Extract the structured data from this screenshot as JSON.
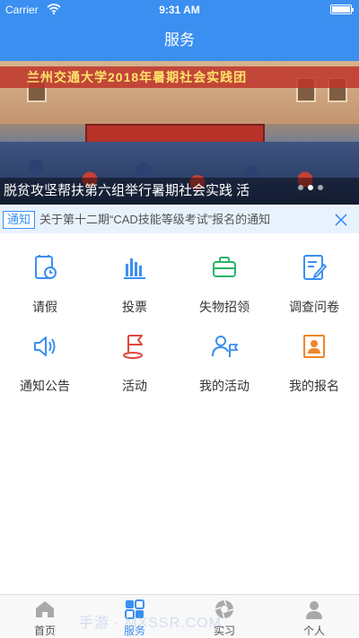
{
  "status_bar": {
    "carrier": "Carrier",
    "time": "9:31 AM",
    "battery_level": 1.0
  },
  "nav": {
    "title": "服务"
  },
  "banner": {
    "photo_text": "兰州交通大学2018年暑期社会实践团",
    "caption": "脱贫攻坚帮扶第六组举行暑期社会实践 活",
    "page_count": 3,
    "active_page": 2
  },
  "notice": {
    "tag": "通知",
    "text": "关于第十二期“CAD技能等级考试”报名的通知"
  },
  "services": [
    {
      "label": "请假",
      "icon": "leave-request-icon"
    },
    {
      "label": "投票",
      "icon": "bar-chart-icon"
    },
    {
      "label": "失物招领",
      "icon": "lost-found-bag-icon"
    },
    {
      "label": "调查问卷",
      "icon": "survey-edit-icon"
    },
    {
      "label": "通知公告",
      "icon": "speaker-icon"
    },
    {
      "label": "活动",
      "icon": "flag-icon"
    },
    {
      "label": "我的活动",
      "icon": "person-flag-icon"
    },
    {
      "label": "我的报名",
      "icon": "id-card-icon"
    }
  ],
  "tabs": [
    {
      "label": "首页",
      "icon": "home-icon",
      "active": false
    },
    {
      "label": "服务",
      "icon": "services-grid-icon",
      "active": true
    },
    {
      "label": "实习",
      "icon": "aperture-icon",
      "active": false
    },
    {
      "label": "个人",
      "icon": "person-icon",
      "active": false
    }
  ],
  "watermark": "手游 · MXSSR.COM",
  "colors": {
    "primary": "#3a8ff0",
    "notice_bg": "#e8f2fd",
    "red_icon": "#e0483e",
    "green_icon": "#2bb36a",
    "orange_icon": "#f0862a"
  }
}
